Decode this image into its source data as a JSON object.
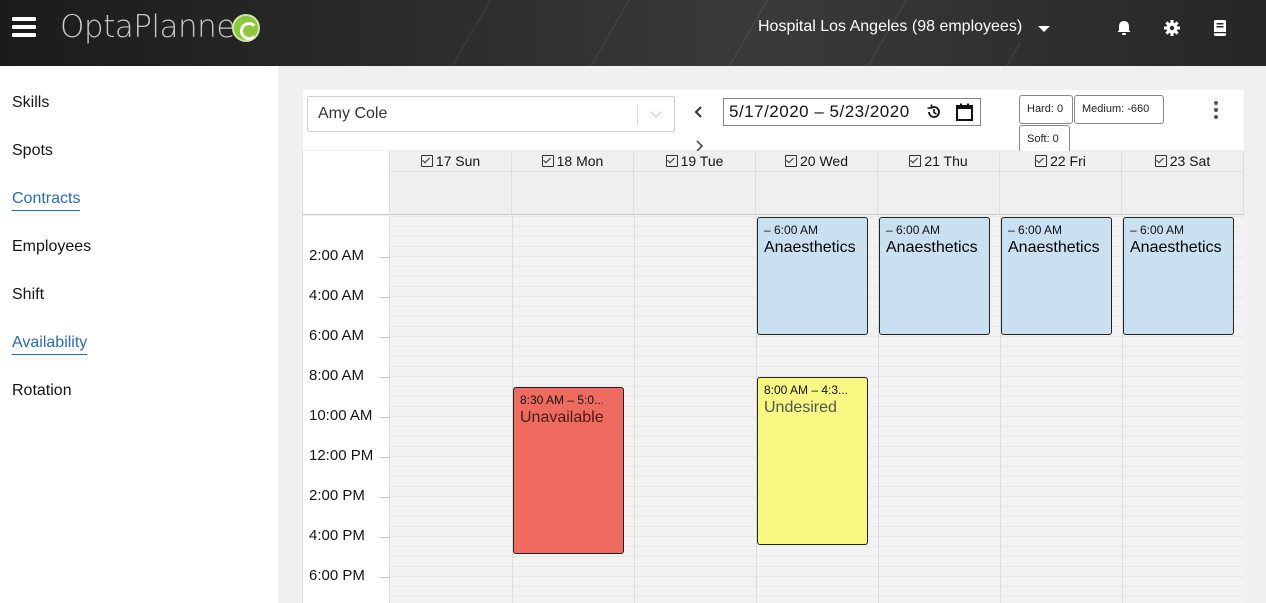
{
  "app": {
    "logo_text": "OptaPlanner",
    "tenant_label": "Hospital Los Angeles (98 employees)",
    "icons": {
      "menu": "hamburger-icon",
      "caret": "caret-down-icon",
      "bell": "bell-icon",
      "gear": "gear-icon",
      "book": "book-icon"
    }
  },
  "sidebar": {
    "items": [
      {
        "label": "Skills",
        "active": false
      },
      {
        "label": "Spots",
        "active": false
      },
      {
        "label": "Contracts",
        "active": true
      },
      {
        "label": "Employees",
        "active": false
      },
      {
        "label": "Shift",
        "active": false
      },
      {
        "label": "Availability",
        "active": true
      },
      {
        "label": "Rotation",
        "active": false
      }
    ]
  },
  "toolbar": {
    "employee": "Amy Cole",
    "date_range": "5/17/2020 – 5/23/2020",
    "scores": {
      "hard": "Hard: 0",
      "medium": "Medium: -660",
      "soft": "Soft: 0"
    }
  },
  "calendar": {
    "days": [
      "17 Sun",
      "18 Mon",
      "19 Tue",
      "20 Wed",
      "21 Thu",
      "22 Fri",
      "23 Sat"
    ],
    "time_labels": [
      "2:00 AM",
      "4:00 AM",
      "6:00 AM",
      "8:00 AM",
      "10:00 AM",
      "12:00 PM",
      "2:00 PM",
      "4:00 PM",
      "6:00 PM"
    ],
    "events": [
      {
        "day": "20 Wed",
        "time": "– 6:00 AM",
        "title": "Anaesthetics",
        "kind": "shift"
      },
      {
        "day": "21 Thu",
        "time": "– 6:00 AM",
        "title": "Anaesthetics",
        "kind": "shift"
      },
      {
        "day": "22 Fri",
        "time": "– 6:00 AM",
        "title": "Anaesthetics",
        "kind": "shift"
      },
      {
        "day": "23 Sat",
        "time": "– 6:00 AM",
        "title": "Anaesthetics",
        "kind": "shift"
      },
      {
        "day": "18 Mon",
        "time": "8:30 AM – 5:0...",
        "title": "Unavailable",
        "kind": "unavailable"
      },
      {
        "day": "20 Wed",
        "time": "8:00 AM – 4:3...",
        "title": "Undesired",
        "kind": "undesired"
      }
    ]
  },
  "colors": {
    "shift": "#c8e0f0",
    "unavailable": "#ef6b5f",
    "undesired": "#f8f882",
    "active_link": "#2b6cb0"
  }
}
